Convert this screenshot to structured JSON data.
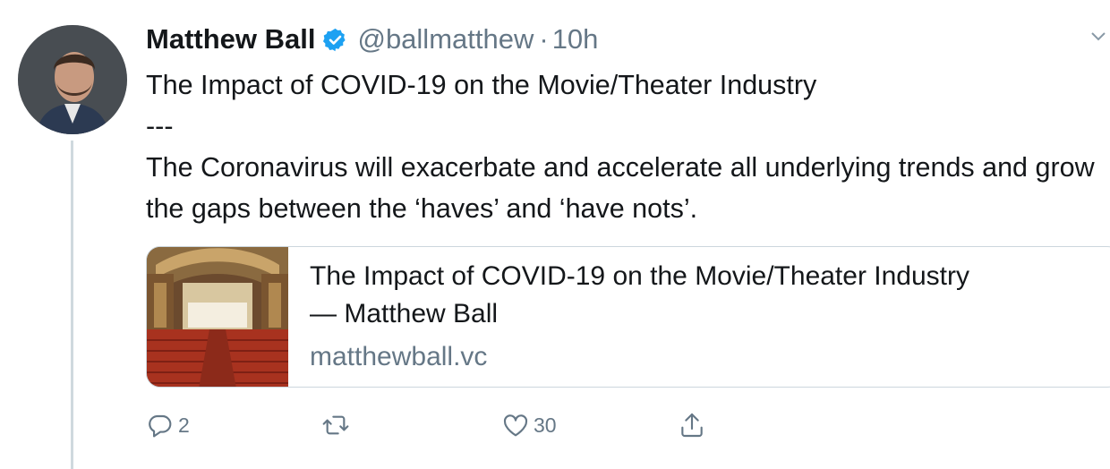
{
  "tweet": {
    "author_name": "Matthew Ball",
    "handle": "@ballmatthew",
    "separator": "·",
    "time": "10h",
    "lines": [
      "The Impact of COVID-19 on the Movie/Theater Industry",
      "---",
      "The Coronavirus will exacerbate and accelerate all underlying trends and grow the gaps between the ‘haves’ and ‘have nots’."
    ]
  },
  "card": {
    "title_line1": "The Impact of COVID-19 on the Movie/Theater Industry",
    "title_line2": "— Matthew Ball",
    "domain": "matthewball.vc",
    "image_icon": "theater-thumbnail"
  },
  "actions": {
    "reply_count": "2",
    "retweet_count": "",
    "like_count": "30"
  },
  "colors": {
    "text": "#14171a",
    "secondary": "#657786",
    "verified": "#1da1f2",
    "border": "#ccd6dd"
  }
}
